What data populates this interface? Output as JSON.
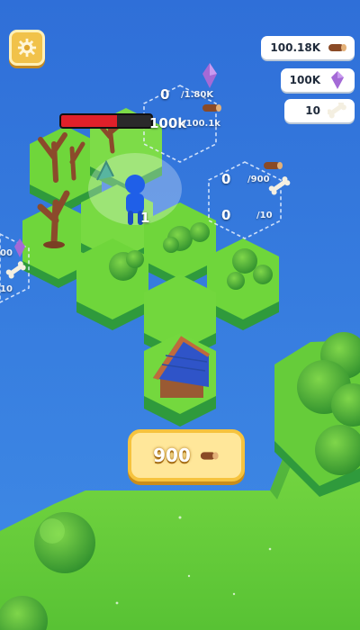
{
  "hud": {
    "wood_count": "100.18K",
    "gem_count": "100K",
    "bone_count": "10"
  },
  "player": {
    "health_fraction": 0.62,
    "level": "1"
  },
  "upgrade_zones": {
    "top_wood_current": "0",
    "top_wood_required": "/1.80K",
    "top_wood_progress": "100k",
    "top_wood_progress_required": "/100.1k",
    "right_wood_current": "0",
    "right_wood_required": "/900",
    "right_bone_current": "0",
    "right_bone_required": "/10",
    "left_gem_value": "00",
    "left_bone_value": "10"
  },
  "build_button": {
    "cost": "900",
    "resource_icon": "wood-log-icon"
  },
  "colors": {
    "water": "#3a7fe0",
    "grass": "#73d23c",
    "hex_top": "#6fd63b",
    "hex_side": "#2f9a3c",
    "button_gold": "#f6c33e"
  }
}
